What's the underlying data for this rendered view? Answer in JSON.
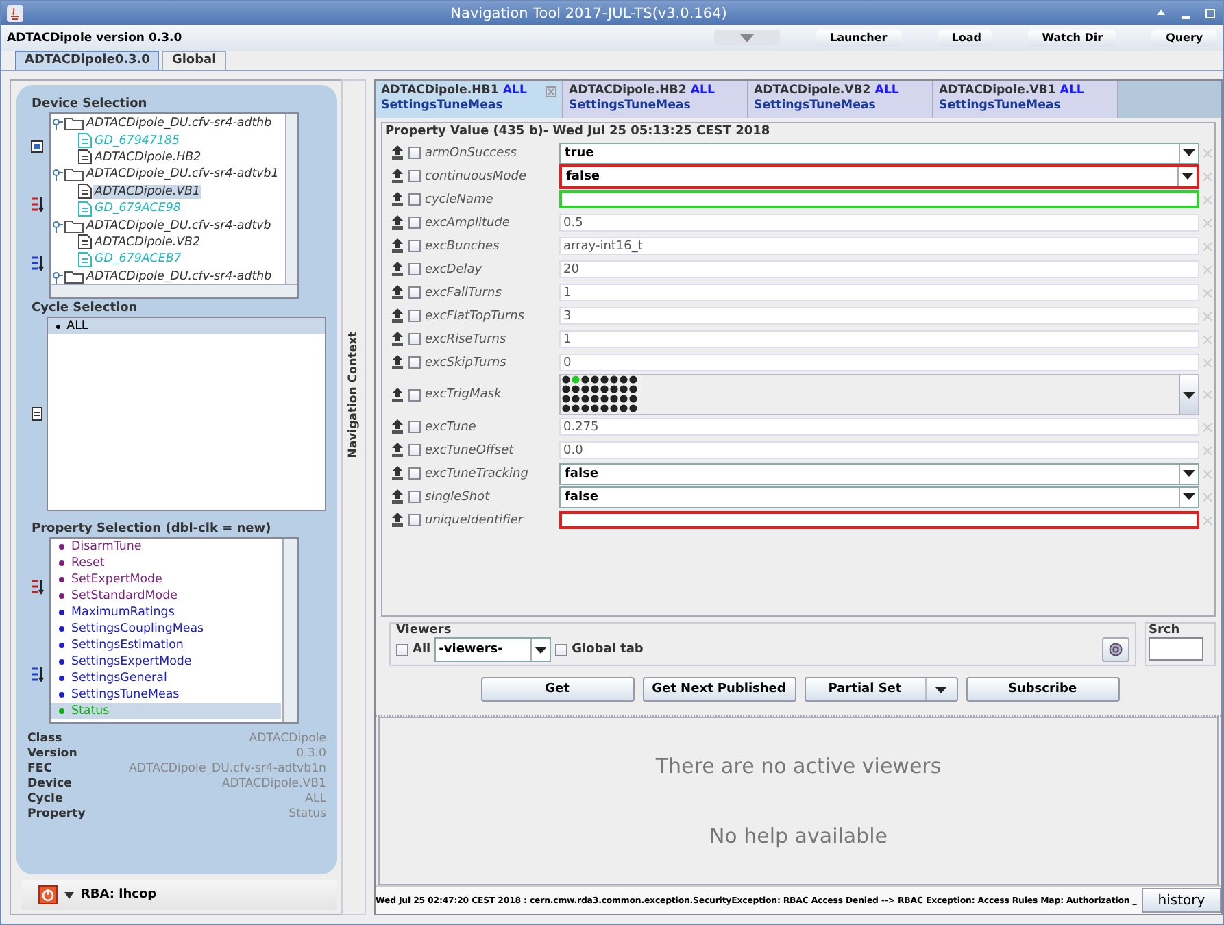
{
  "window": {
    "title": "Navigation Tool 2017-JUL-TS(v3.0.164)"
  },
  "toolbar": {
    "version_label": "ADTACDipole version 0.3.0",
    "buttons": [
      "Launcher",
      "Load",
      "Watch Dir",
      "Query"
    ]
  },
  "main_tabs": [
    {
      "label": "ADTACDipole0.3.0",
      "selected": true
    },
    {
      "label": "Global",
      "selected": false
    }
  ],
  "device_selection": {
    "title": "Device Selection",
    "tree": [
      {
        "label": "ADTACDipole_DU.cfv-sr4-adthb",
        "kind": "folder",
        "selected": false,
        "children": [
          {
            "label": "GD_67947185",
            "kind": "gd",
            "selected": false
          },
          {
            "label": "ADTACDipole.HB2",
            "kind": "device",
            "selected": false
          }
        ]
      },
      {
        "label": "ADTACDipole_DU.cfv-sr4-adtvb1",
        "kind": "folder",
        "selected": false,
        "children": [
          {
            "label": "ADTACDipole.VB1",
            "kind": "device",
            "selected": true
          },
          {
            "label": "GD_679ACE98",
            "kind": "gd",
            "selected": false
          }
        ]
      },
      {
        "label": "ADTACDipole_DU.cfv-sr4-adtvb",
        "kind": "folder",
        "selected": false,
        "children": [
          {
            "label": "ADTACDipole.VB2",
            "kind": "device",
            "selected": false
          },
          {
            "label": "GD_679ACEB7",
            "kind": "gd",
            "selected": false
          }
        ]
      },
      {
        "label": "ADTACDipole_DU.cfv-sr4-adthb",
        "kind": "folder",
        "selected": false
      }
    ]
  },
  "cycle_selection": {
    "title": "Cycle Selection",
    "items": [
      {
        "label": "ALL",
        "selected": true
      }
    ]
  },
  "property_selection": {
    "title": "Property Selection (dbl-clk = new)",
    "items": [
      {
        "label": "DisarmTune",
        "kind": "command",
        "selected": false
      },
      {
        "label": "Reset",
        "kind": "command",
        "selected": false
      },
      {
        "label": "SetExpertMode",
        "kind": "command",
        "selected": false
      },
      {
        "label": "SetStandardMode",
        "kind": "command",
        "selected": false
      },
      {
        "label": "MaximumRatings",
        "kind": "setting",
        "selected": false
      },
      {
        "label": "SettingsCouplingMeas",
        "kind": "setting",
        "selected": false
      },
      {
        "label": "SettingsEstimation",
        "kind": "setting",
        "selected": false
      },
      {
        "label": "SettingsExpertMode",
        "kind": "setting",
        "selected": false
      },
      {
        "label": "SettingsGeneral",
        "kind": "setting",
        "selected": false
      },
      {
        "label": "SettingsTuneMeas",
        "kind": "setting",
        "selected": false
      },
      {
        "label": "Status",
        "kind": "status",
        "selected": true
      }
    ]
  },
  "info": [
    {
      "label": "Class",
      "value": "ADTACDipole"
    },
    {
      "label": "Version",
      "value": "0.3.0"
    },
    {
      "label": "FEC",
      "value": "ADTACDipole_DU.cfv-sr4-adtvb1n"
    },
    {
      "label": "Device",
      "value": "ADTACDipole.VB1"
    },
    {
      "label": "Cycle",
      "value": "ALL"
    },
    {
      "label": "Property",
      "value": "Status"
    }
  ],
  "rba": {
    "label": "RBA: lhcop"
  },
  "navigation_context": {
    "label": "Navigation Context"
  },
  "property_tabs": [
    {
      "device": "ADTACDipole.HB1",
      "cycle": "ALL",
      "property": "SettingsTuneMeas",
      "selected": true
    },
    {
      "device": "ADTACDipole.HB2",
      "cycle": "ALL",
      "property": "SettingsTuneMeas",
      "selected": false
    },
    {
      "device": "ADTACDipole.VB2",
      "cycle": "ALL",
      "property": "SettingsTuneMeas",
      "selected": false
    },
    {
      "device": "ADTACDipole.VB1",
      "cycle": "ALL",
      "property": "SettingsTuneMeas",
      "selected": false
    }
  ],
  "property_value": {
    "title": "Property Value (435 b)- Wed Jul 25 05:13:25 CEST 2018",
    "rows": [
      {
        "name": "armOnSuccess",
        "kind": "combo",
        "value": "true",
        "checked": false,
        "error": false,
        "valid": false
      },
      {
        "name": "continuousMode",
        "kind": "combo",
        "value": "false",
        "checked": false,
        "error": true,
        "valid": false
      },
      {
        "name": "cycleName",
        "kind": "text",
        "checked": false,
        "error": false,
        "valid": true
      },
      {
        "name": "excAmplitude",
        "kind": "text",
        "value": "0.5",
        "checked": false,
        "error": false,
        "valid": false
      },
      {
        "name": "excBunches",
        "kind": "text",
        "value": "array-int16_t",
        "checked": false,
        "error": false,
        "valid": false
      },
      {
        "name": "excDelay",
        "kind": "text",
        "value": "20",
        "checked": false,
        "error": false,
        "valid": false
      },
      {
        "name": "excFallTurns",
        "kind": "text",
        "value": "1",
        "checked": false,
        "error": false,
        "valid": false
      },
      {
        "name": "excFlatTopTurns",
        "kind": "text",
        "value": "3",
        "checked": false,
        "error": false,
        "valid": false
      },
      {
        "name": "excRiseTurns",
        "kind": "text",
        "value": "1",
        "checked": false,
        "error": false,
        "valid": false
      },
      {
        "name": "excSkipTurns",
        "kind": "text",
        "value": "0",
        "checked": false,
        "error": false,
        "valid": false
      },
      {
        "name": "excTrigMask",
        "kind": "mask",
        "checked": false,
        "error": false,
        "valid": false
      },
      {
        "name": "excTune",
        "kind": "text",
        "value": "0.275",
        "checked": false,
        "error": false,
        "valid": false
      },
      {
        "name": "excTuneOffset",
        "kind": "text",
        "value": "0.0",
        "checked": false,
        "error": false,
        "valid": false
      },
      {
        "name": "excTuneTracking",
        "kind": "combo",
        "value": "false",
        "checked": false,
        "error": false,
        "valid": false
      },
      {
        "name": "singleShot",
        "kind": "combo",
        "value": "false",
        "checked": false,
        "error": false,
        "valid": false
      },
      {
        "name": "uniqueIdentifier",
        "kind": "text",
        "checked": false,
        "error": true,
        "valid": false
      }
    ]
  },
  "viewers": {
    "title": "Viewers",
    "all_label": "All",
    "all_checked": false,
    "dropdown": "-viewers-",
    "global_tab_label": "Global tab",
    "global_tab_checked": false,
    "search_title": "Srch"
  },
  "actions": [
    {
      "label": "Get",
      "kind": "button"
    },
    {
      "label": "Get Next Published",
      "kind": "button"
    },
    {
      "label": "Partial Set",
      "kind": "split"
    },
    {
      "label": "Subscribe",
      "kind": "button"
    }
  ],
  "messages": [
    "There are no active viewers",
    "No help available"
  ],
  "status_bar": {
    "message": "Wed Jul 25 02:47:20 CEST 2018 : cern.cmw.rda3.common.exception.SecurityException: RBAC Access Denied --> RBAC Exception: Access Rules Map: Authorization _",
    "button": "history"
  }
}
